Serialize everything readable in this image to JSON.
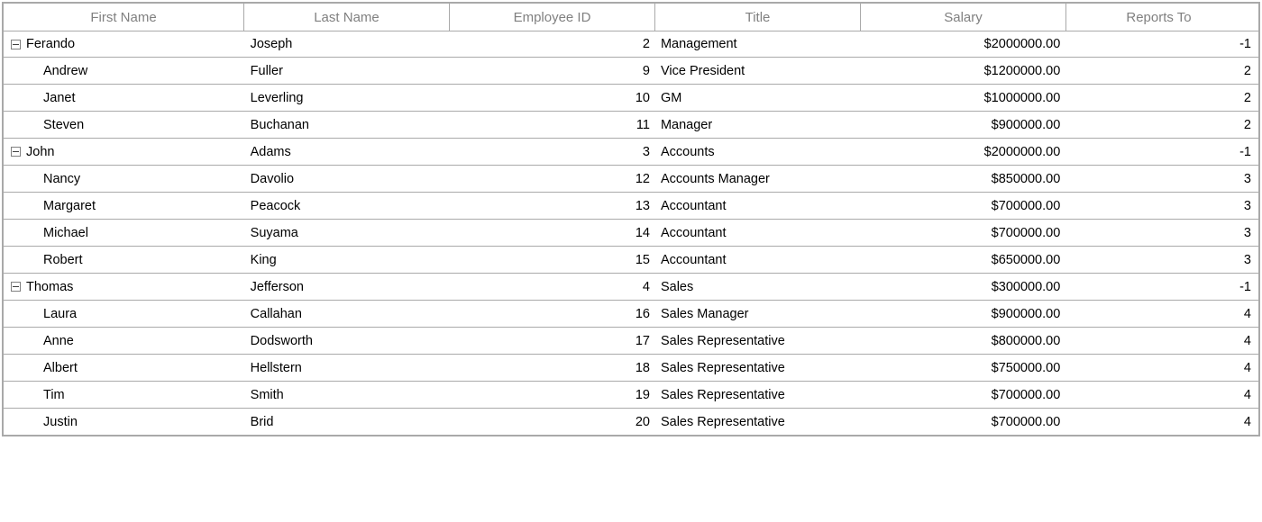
{
  "columns": {
    "firstname": "First Name",
    "lastname": "Last Name",
    "empid": "Employee ID",
    "title": "Title",
    "salary": "Salary",
    "reports": "Reports To"
  },
  "rows": [
    {
      "level": 0,
      "expandable": true,
      "firstname": "Ferando",
      "lastname": "Joseph",
      "empid": "2",
      "title": "Management",
      "salary": "$2000000.00",
      "reports": "-1"
    },
    {
      "level": 1,
      "expandable": false,
      "firstname": "Andrew",
      "lastname": "Fuller",
      "empid": "9",
      "title": "Vice President",
      "salary": "$1200000.00",
      "reports": "2"
    },
    {
      "level": 1,
      "expandable": false,
      "firstname": "Janet",
      "lastname": "Leverling",
      "empid": "10",
      "title": "GM",
      "salary": "$1000000.00",
      "reports": "2"
    },
    {
      "level": 1,
      "expandable": false,
      "firstname": "Steven",
      "lastname": "Buchanan",
      "empid": "11",
      "title": "Manager",
      "salary": "$900000.00",
      "reports": "2"
    },
    {
      "level": 0,
      "expandable": true,
      "firstname": "John",
      "lastname": "Adams",
      "empid": "3",
      "title": "Accounts",
      "salary": "$2000000.00",
      "reports": "-1"
    },
    {
      "level": 1,
      "expandable": false,
      "firstname": "Nancy",
      "lastname": "Davolio",
      "empid": "12",
      "title": "Accounts Manager",
      "salary": "$850000.00",
      "reports": "3"
    },
    {
      "level": 1,
      "expandable": false,
      "firstname": "Margaret",
      "lastname": "Peacock",
      "empid": "13",
      "title": "Accountant",
      "salary": "$700000.00",
      "reports": "3"
    },
    {
      "level": 1,
      "expandable": false,
      "firstname": "Michael",
      "lastname": "Suyama",
      "empid": "14",
      "title": "Accountant",
      "salary": "$700000.00",
      "reports": "3"
    },
    {
      "level": 1,
      "expandable": false,
      "firstname": "Robert",
      "lastname": "King",
      "empid": "15",
      "title": "Accountant",
      "salary": "$650000.00",
      "reports": "3"
    },
    {
      "level": 0,
      "expandable": true,
      "firstname": "Thomas",
      "lastname": "Jefferson",
      "empid": "4",
      "title": "Sales",
      "salary": "$300000.00",
      "reports": "-1"
    },
    {
      "level": 1,
      "expandable": false,
      "firstname": "Laura",
      "lastname": "Callahan",
      "empid": "16",
      "title": "Sales Manager",
      "salary": "$900000.00",
      "reports": "4"
    },
    {
      "level": 1,
      "expandable": false,
      "firstname": "Anne",
      "lastname": "Dodsworth",
      "empid": "17",
      "title": "Sales Representative",
      "salary": "$800000.00",
      "reports": "4"
    },
    {
      "level": 1,
      "expandable": false,
      "firstname": "Albert",
      "lastname": "Hellstern",
      "empid": "18",
      "title": "Sales Representative",
      "salary": "$750000.00",
      "reports": "4"
    },
    {
      "level": 1,
      "expandable": false,
      "firstname": "Tim",
      "lastname": "Smith",
      "empid": "19",
      "title": "Sales Representative",
      "salary": "$700000.00",
      "reports": "4"
    },
    {
      "level": 1,
      "expandable": false,
      "firstname": "Justin",
      "lastname": "Brid",
      "empid": "20",
      "title": "Sales Representative",
      "salary": "$700000.00",
      "reports": "4"
    }
  ]
}
